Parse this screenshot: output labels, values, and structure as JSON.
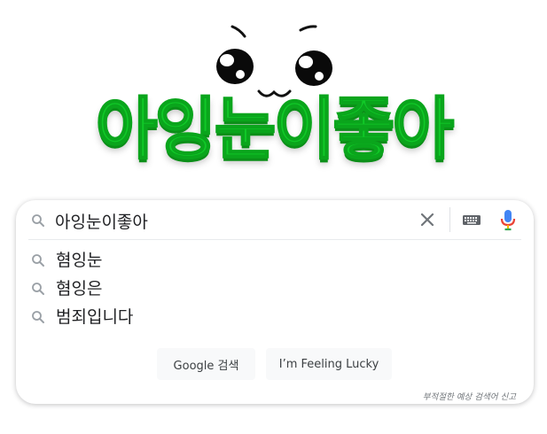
{
  "logo": {
    "text": "아잉눈이좋아",
    "color": "#10c928"
  },
  "search": {
    "query": "아잉눈이좋아",
    "icon": "search-icon",
    "clear_icon": "close-icon",
    "keyboard_icon": "keyboard-icon",
    "voice_icon": "mic-icon"
  },
  "suggestions": [
    {
      "label": "혐잉눈",
      "icon": "search-icon"
    },
    {
      "label": "혐잉은",
      "icon": "search-icon"
    },
    {
      "label": "범죄입니다",
      "icon": "search-icon"
    }
  ],
  "buttons": {
    "search_label": "Google 검색",
    "lucky_label": "I’m Feeling Lucky"
  },
  "report_label": "부적절한 예상 검색어 신고"
}
